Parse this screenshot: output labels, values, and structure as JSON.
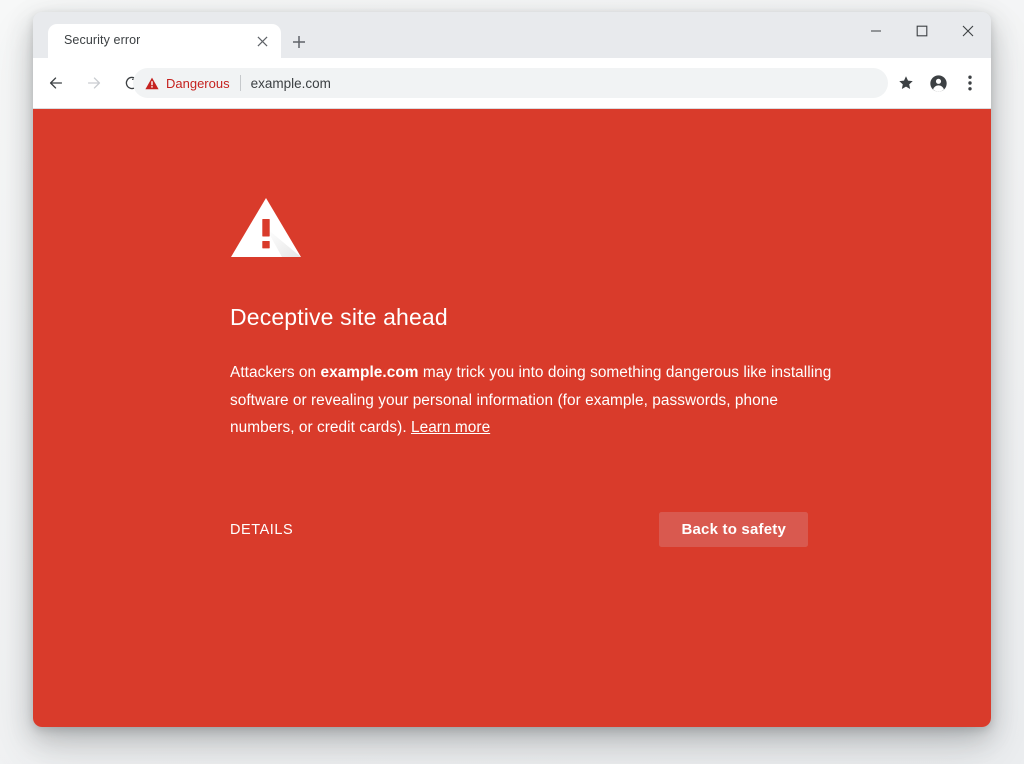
{
  "window": {
    "controls": {
      "minimize": "minimize-icon",
      "maximize": "maximize-icon",
      "close": "close-icon"
    }
  },
  "tabstrip": {
    "tabs": [
      {
        "title": "Security error",
        "close_icon": "close-icon",
        "active": true
      }
    ],
    "new_tab_icon": "plus-icon"
  },
  "toolbar": {
    "back_icon": "arrow-left-icon",
    "forward_icon": "arrow-right-icon",
    "reload_icon": "reload-icon",
    "omnibox": {
      "warning_icon": "warning-triangle-icon",
      "security_label": "Dangerous",
      "url": "example.com"
    },
    "bookmark_icon": "star-icon",
    "profile_icon": "account-circle-icon",
    "menu_icon": "three-dot-menu-icon"
  },
  "interstitial": {
    "icon": "warning-triangle-icon",
    "heading": "Deceptive site ahead",
    "body": {
      "before_domain": "Attackers on ",
      "domain": "example.com",
      "after_domain": " may trick you into doing something dangerous like installing software or revealing your personal information (for example, passwords, phone numbers, or credit cards). ",
      "link": "Learn more"
    },
    "details_label": "DETAILS",
    "primary_label": "Back to safety"
  },
  "colors": {
    "page_background": "#d93b2b",
    "primary_button": "#d9594f",
    "danger_text": "#c5221f",
    "tabstrip": "#e8eaed",
    "omnibox": "#f1f3f4"
  }
}
